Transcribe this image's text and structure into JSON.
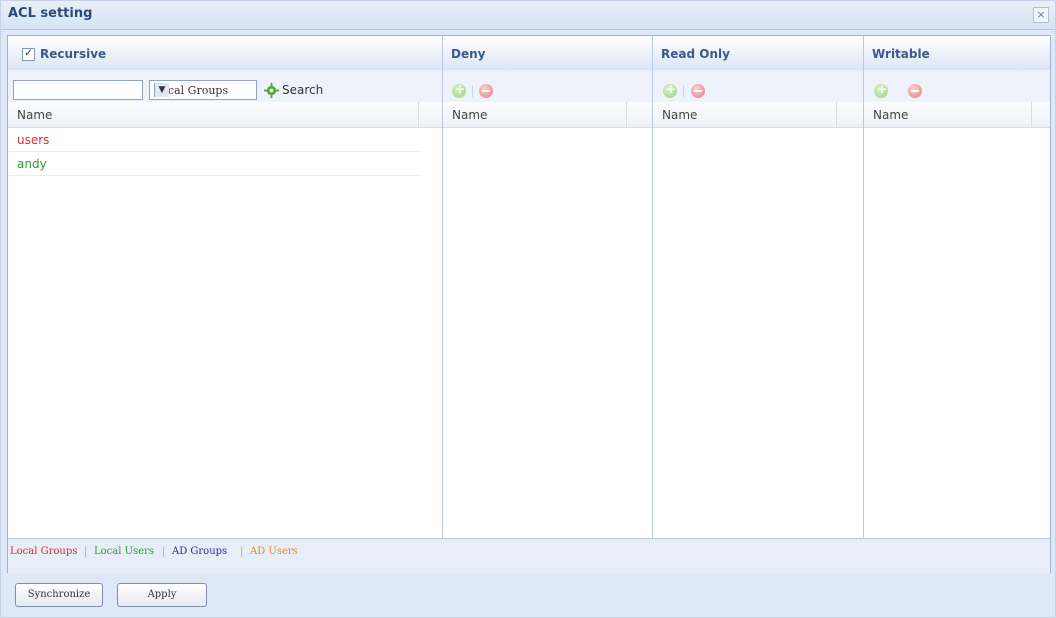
{
  "window": {
    "title": "ACL setting",
    "close_label": "×"
  },
  "left_panel": {
    "recursive_label": "Recursive",
    "recursive_checked": true,
    "search_value": "",
    "group_select": "Local Groups",
    "search_label": "Search",
    "column_header": "Name",
    "rows": [
      {
        "name": "users",
        "color": "#d62b2b"
      },
      {
        "name": "andy",
        "color": "#2f9a2f"
      }
    ]
  },
  "panels": [
    {
      "title": "Deny",
      "column_header": "Name"
    },
    {
      "title": "Read Only",
      "column_header": "Name"
    },
    {
      "title": "Writable",
      "column_header": "Name"
    }
  ],
  "legend": {
    "local_groups": "Local Groups",
    "local_users": "Local Users",
    "ad_groups": "AD Groups",
    "ad_users": "AD Users",
    "separator": "|"
  },
  "buttons": {
    "synchronize": "Synchronize",
    "apply": "Apply"
  },
  "colors": {
    "local_groups": "#d62b2b",
    "local_users": "#2f9a2f",
    "ad_groups": "#2a2aa0",
    "ad_users": "#e08a2a"
  }
}
